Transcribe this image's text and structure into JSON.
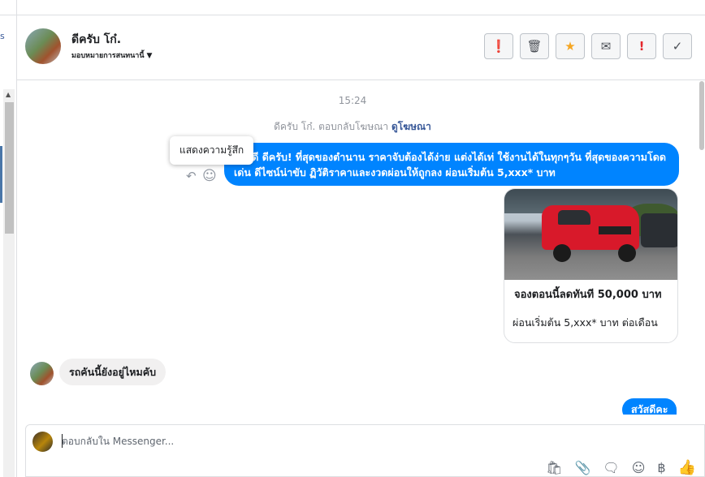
{
  "sidebar": {
    "link_fragment": "s"
  },
  "header": {
    "name": "ดีครับ โก๋.",
    "assign_label": "มอบหมายการสนทนานี้",
    "actions": [
      {
        "name": "mark-spam-button",
        "glyph": "❗"
      },
      {
        "name": "delete-button",
        "glyph": "🗑"
      },
      {
        "name": "star-button",
        "glyph": "★"
      },
      {
        "name": "mark-unread-button",
        "glyph": "✉"
      },
      {
        "name": "flag-button",
        "glyph": "!"
      },
      {
        "name": "mark-done-button",
        "glyph": "✓"
      }
    ]
  },
  "conversation": {
    "timestamp": "15:24",
    "ad_note": "ดีครับ โก๋. ตอบกลับโฆษณา",
    "ad_link": "ดูโฆษณา",
    "tooltip": "แสดงความรู้สึก",
    "outgoing_message": "สวัสดี ดีครับ! ที่สุดของตำนาน ราคาจับต้องได้ง่าย แต่งได้เท่ ใช้งานได้ในทุกๆวัน ที่สุดของความโดดเด่น ดีไซน์น่าขับ ฏิวัติราคาและงวดผ่อนให้ถูกลง ผ่อนเริ่มต้น 5,xxx* บาท",
    "card": {
      "title": "จองตอนนี้ลดทันที 50,000 บาท",
      "subtitle": "ผ่อนเริ่มต้น 5,xxx* บาท ต่อเดือน"
    },
    "incoming_message": "รถคันนี้ยังอยู่ไหมคับ",
    "outgoing_message_2": "สวัสดีคะ"
  },
  "composer": {
    "placeholder": "ตอบกลับใน Messenger...",
    "tools": [
      "bag-icon",
      "attachment-icon",
      "saved-replies-icon",
      "emoji-icon",
      "baht-icon",
      "like-icon"
    ]
  }
}
